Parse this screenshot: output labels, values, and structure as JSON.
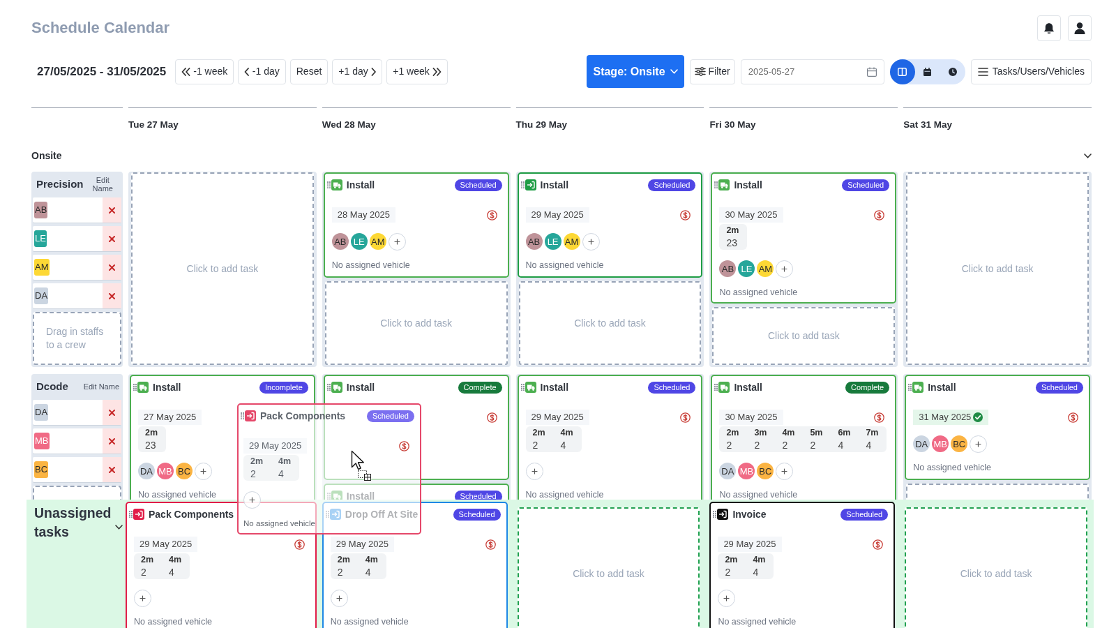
{
  "header": {
    "title": "Schedule Calendar"
  },
  "toolbar": {
    "date_range": "27/05/2025 - 31/05/2025",
    "nav_buttons": [
      {
        "label": "-1 week",
        "kind": "rewind"
      },
      {
        "label": "-1 day",
        "kind": "back"
      },
      {
        "label": "Reset",
        "kind": "plain"
      },
      {
        "label": "+1 day",
        "kind": "forward"
      },
      {
        "label": "+1 week",
        "kind": "fastforward"
      }
    ],
    "stage_button": {
      "label": "Stage: Onsite"
    },
    "filter_button": {
      "label": "Filter"
    },
    "date_field": {
      "value": "2025-05-27"
    },
    "view_toggle": [
      {
        "kind": "columns",
        "selected": true
      },
      {
        "kind": "calendar",
        "selected": false
      },
      {
        "kind": "clock",
        "selected": false
      }
    ],
    "panel_button": {
      "label": "Tasks/Users/Vehicles"
    }
  },
  "days": [
    "Tue 27 May",
    "Wed 28 May",
    "Thu 29 May",
    "Fri 30 May",
    "Sat 31 May"
  ],
  "stage": {
    "label": "Onsite"
  },
  "crews": [
    {
      "name": "Precision",
      "edit_label": "Edit Name",
      "staff": [
        {
          "initials": "AB",
          "color": "#bf9399"
        },
        {
          "initials": "LE",
          "color": "#26a69a"
        },
        {
          "initials": "AM",
          "color": "#fdd835"
        },
        {
          "initials": "DA",
          "color": "#cbd5e1"
        }
      ],
      "drop_slot": true,
      "drop_hint": "Drag in staffs to a crew",
      "days": [
        {
          "add_slot": true,
          "add_hint": "Click to add task"
        },
        {
          "tasks": [
            {
              "title": "Install",
              "kind": "truck",
              "color": "#4caf50",
              "badge": {
                "label": "Scheduled",
                "color": "#4f46e5"
              },
              "date": "28 May 2025",
              "date_confirmed": false,
              "billing": true,
              "staff": [
                {
                  "initials": "AB",
                  "color": "#bf9399"
                },
                {
                  "initials": "LE",
                  "color": "#26a69a"
                },
                {
                  "initials": "AM",
                  "color": "#fdd835"
                }
              ],
              "can_add_staff": true,
              "vehicle": "No assigned vehicle"
            }
          ],
          "add_slot": true,
          "add_hint": "Click to add task"
        },
        {
          "tasks": [
            {
              "title": "Install",
              "kind": "entry",
              "color": "#1f9d45",
              "badge": {
                "label": "Scheduled",
                "color": "#4f46e5"
              },
              "date": "29 May 2025",
              "date_confirmed": false,
              "billing": true,
              "staff": [
                {
                  "initials": "AB",
                  "color": "#bf9399"
                },
                {
                  "initials": "LE",
                  "color": "#26a69a"
                },
                {
                  "initials": "AM",
                  "color": "#fdd835"
                }
              ],
              "can_add_staff": true,
              "vehicle": "No assigned vehicle"
            }
          ],
          "add_slot": true,
          "add_hint": "Click to add task"
        },
        {
          "tasks": [
            {
              "title": "Install",
              "kind": "truck",
              "color": "#4caf50",
              "badge": {
                "label": "Scheduled",
                "color": "#4f46e5"
              },
              "date": "30 May 2025",
              "date_confirmed": false,
              "billing": true,
              "durations": [
                {
                  "label": "2m",
                  "value": "23"
                }
              ],
              "staff": [
                {
                  "initials": "AB",
                  "color": "#bf9399"
                },
                {
                  "initials": "LE",
                  "color": "#26a69a"
                },
                {
                  "initials": "AM",
                  "color": "#fdd835"
                }
              ],
              "can_add_staff": true,
              "vehicle": "No assigned vehicle"
            }
          ],
          "add_slot": true,
          "add_hint": "Click to add task"
        },
        {
          "add_slot": true,
          "add_hint": "Click to add task"
        }
      ]
    },
    {
      "name": "Dcode",
      "edit_label": "Edit Name",
      "staff": [
        {
          "initials": "DA",
          "color": "#cbd5e1"
        },
        {
          "initials": "MB",
          "color": "#f06a85"
        },
        {
          "initials": "BC",
          "color": "#fbb443"
        }
      ],
      "drop_slot": true,
      "days": [
        {
          "tasks": [
            {
              "title": "Install",
              "kind": "truck",
              "color": "#4caf50",
              "badge": {
                "label": "Incomplete",
                "color": "#4f46e5"
              },
              "date": "27 May 2025",
              "date_confirmed": false,
              "billing": false,
              "durations": [
                {
                  "label": "2m",
                  "value": "23"
                }
              ],
              "staff": [
                {
                  "initials": "DA",
                  "color": "#cbd5e1"
                },
                {
                  "initials": "MB",
                  "color": "#f06a85"
                },
                {
                  "initials": "BC",
                  "color": "#fbb443"
                }
              ],
              "can_add_staff": true,
              "vehicle": "No assigned vehicle"
            }
          ],
          "add_slot": false
        },
        {
          "tasks": [
            {
              "title": "Install",
              "kind": "truck",
              "color": "#4caf50",
              "badge": {
                "label": "Complete",
                "color": "#177a3c"
              },
              "billing": true
            },
            {
              "title": "Install",
              "kind": "truck",
              "color": "#4caf50",
              "badge": {
                "label": "Scheduled",
                "color": "#4f46e5"
              }
            }
          ],
          "add_slot": false
        },
        {
          "tasks": [
            {
              "title": "Install",
              "kind": "truck",
              "color": "#4caf50",
              "badge": {
                "label": "Scheduled",
                "color": "#4f46e5"
              },
              "date": "29 May 2025",
              "date_confirmed": false,
              "billing": true,
              "durations": [
                {
                  "label": "2m",
                  "value": "2"
                },
                {
                  "label": "4m",
                  "value": "4"
                }
              ],
              "can_add_staff": true,
              "vehicle": "No assigned vehicle"
            }
          ],
          "add_slot": false
        },
        {
          "tasks": [
            {
              "title": "Install",
              "kind": "truck",
              "color": "#4caf50",
              "badge": {
                "label": "Complete",
                "color": "#177a3c"
              },
              "date": "30 May 2025",
              "date_confirmed": false,
              "billing": true,
              "durations": [
                {
                  "label": "2m",
                  "value": "2"
                },
                {
                  "label": "3m",
                  "value": "2"
                },
                {
                  "label": "4m",
                  "value": "2"
                },
                {
                  "label": "5m",
                  "value": "2"
                },
                {
                  "label": "6m",
                  "value": "4"
                },
                {
                  "label": "7m",
                  "value": "4"
                }
              ],
              "staff": [
                {
                  "initials": "DA",
                  "color": "#cbd5e1"
                },
                {
                  "initials": "MB",
                  "color": "#f06a85"
                },
                {
                  "initials": "BC",
                  "color": "#fbb443"
                }
              ],
              "can_add_staff": true,
              "vehicle": "No assigned vehicle"
            }
          ],
          "add_slot": false
        },
        {
          "tasks": [
            {
              "title": "Install",
              "kind": "truck",
              "color": "#4caf50",
              "badge": {
                "label": "Scheduled",
                "color": "#4f46e5"
              },
              "date": "31 May 2025",
              "date_confirmed": true,
              "billing": true,
              "staff": [
                {
                  "initials": "DA",
                  "color": "#cbd5e1"
                },
                {
                  "initials": "MB",
                  "color": "#f06a85"
                },
                {
                  "initials": "BC",
                  "color": "#fbb443"
                }
              ],
              "can_add_staff": true,
              "vehicle": "No assigned vehicle"
            }
          ],
          "add_slot": true
        }
      ]
    }
  ],
  "unassigned": {
    "label": "Unassigned tasks",
    "days": [
      {
        "tasks": [
          {
            "title": "Pack Components",
            "kind": "entry",
            "color": "#e11d48",
            "date": "29 May 2025",
            "date_confirmed": false,
            "billing": true,
            "durations": [
              {
                "label": "2m",
                "value": "2"
              },
              {
                "label": "4m",
                "value": "4"
              }
            ],
            "can_add_staff": true,
            "vehicle": "No assigned vehicle"
          }
        ],
        "add_slot": false
      },
      {
        "tasks": [
          {
            "title": "Drop Off At Site",
            "kind": "entry",
            "color": "#1e88e5",
            "badge": {
              "label": "Scheduled",
              "color": "#4f46e5"
            },
            "date": "29 May 2025",
            "date_confirmed": false,
            "billing": true,
            "durations": [
              {
                "label": "2m",
                "value": "2"
              },
              {
                "label": "4m",
                "value": "4"
              }
            ],
            "can_add_staff": true,
            "vehicle": "No assigned vehicle"
          }
        ],
        "add_slot": false
      },
      {
        "add_slot": true,
        "add_hint": "Click to add task"
      },
      {
        "tasks": [
          {
            "title": "Invoice",
            "kind": "entry",
            "color": "#111111",
            "badge": {
              "label": "Scheduled",
              "color": "#4f46e5"
            },
            "date": "29 May 2025",
            "date_confirmed": false,
            "billing": true,
            "durations": [
              {
                "label": "2m",
                "value": "2"
              },
              {
                "label": "4m",
                "value": "4"
              }
            ],
            "can_add_staff": true,
            "vehicle": "No assigned vehicle"
          }
        ],
        "add_slot": false
      },
      {
        "add_slot": true,
        "add_hint": "Click to add task"
      }
    ]
  },
  "drag_preview": {
    "title": "Pack Components",
    "kind": "entry",
    "color": "#e5486a",
    "badge": {
      "label": "Scheduled",
      "color": "#7b6ff0"
    },
    "date": "29 May 2025",
    "date_confirmed": false,
    "billing": true,
    "durations": [
      {
        "label": "2m",
        "value": "2"
      },
      {
        "label": "4m",
        "value": "4"
      }
    ],
    "can_add_staff": true,
    "vehicle": "No assigned vehicle"
  }
}
